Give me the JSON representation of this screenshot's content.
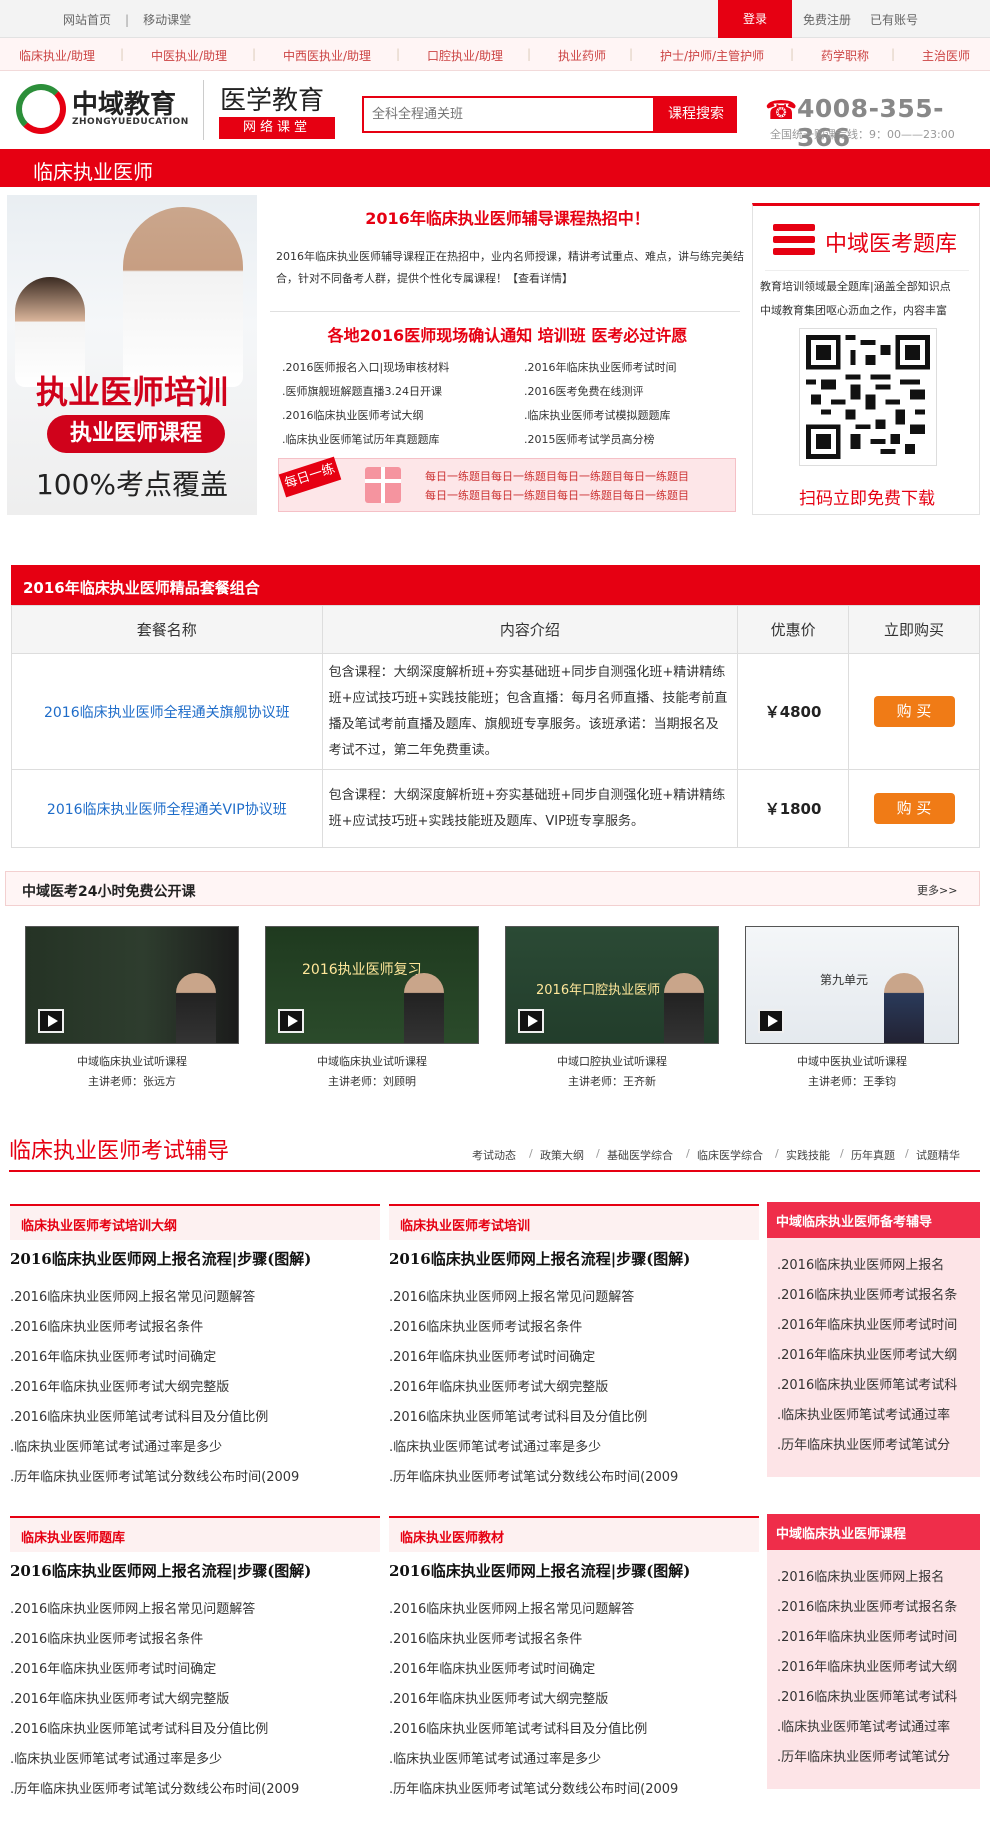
{
  "topbar": {
    "home": "网站首页",
    "mobile": "移动课堂",
    "sep": "|",
    "login": "登录",
    "register": "免费注册",
    "has_account": "已有账号"
  },
  "subnav": {
    "items": [
      "临床执业/助理",
      "中医执业/助理",
      "中西医执业/助理",
      "口腔执业/助理",
      "执业药师",
      "护士/护师/主管护师",
      "药学职称",
      "主治医师"
    ],
    "sep": "|"
  },
  "header": {
    "logo_cn": "中域教育",
    "logo_en": "ZHONGYUEDUCATION",
    "brand": "医学教育",
    "brand_sub": "网络课堂",
    "search_placeholder": "全科全程通关班",
    "search_button": "课程搜索",
    "phone_icon": "☎",
    "phone": "4008-355-366",
    "phone_sub": "全国统一购课专线：9：00——23:00"
  },
  "page_title": "临床执业医师",
  "hero": {
    "line1": "执业医师培训",
    "line2": "执业医师课程",
    "line3": "100%考点覆盖"
  },
  "feature": {
    "headline1": "2016年临床执业医师辅导课程热招中！",
    "paragraph": "2016年临床执业医师辅导课程正在热招中，业内名师授课，精讲考试重点、难点，讲与练完美结合，针对不同备考人群，提供个性化专属课程！【查看详情】",
    "headline2": "各地2016医师现场确认通知 培训班 医考必过许愿",
    "links": [
      ".2016医师报名入口|现场审核材料",
      ".2016年临床执业医师考试时间",
      ".医师旗舰班解题直播3.24日开课",
      ".2016医考免费在线测评",
      ".2016临床执业医师考试大纲",
      ".临床执业医师考试模拟题题库",
      ".临床执业医师笔试历年真题题库",
      ".2015医师考试学员高分榜"
    ],
    "daily_tag": "每日一练",
    "daily_line1": "每日一练题目每日一练题目每日一练题目每日一练题目",
    "daily_line2": "每日一练题目每日一练题目每日一练题目每日一练题目"
  },
  "qr": {
    "title": "中域医考题库",
    "desc1": "教育培训领域最全题库|涵盖全部知识点",
    "desc2": "中域教育集团呕心沥血之作，内容丰富",
    "caption": "扫码立即免费下载"
  },
  "packages": {
    "title": "2016年临床执业医师精品套餐组合",
    "headers": [
      "套餐名称",
      "内容介绍",
      "优惠价",
      "立即购买"
    ],
    "rows": [
      {
        "name": "2016临床执业医师全程通关旗舰协议班",
        "desc": "包含课程：大纲深度解析班+夯实基础班+同步自测强化班+精讲精练班+应试技巧班+实践技能班；包含直播：每月名师直播、技能考前直播及笔试考前直播及题库、旗舰班专享服务。该班承诺：当期报名及考试不过，第二年免费重读。",
        "price": "￥4800",
        "buy": "购 买"
      },
      {
        "name": "2016临床执业医师全程通关VIP协议班",
        "desc": "包含课程：大纲深度解析班+夯实基础班+同步自测强化班+精讲精练班+应试技巧班+实践技能班及题库、VIP班专享服务。",
        "price": "￥1800",
        "buy": "购 买"
      }
    ]
  },
  "open_class": {
    "title": "中域医考24小时免费公开课",
    "more": "更多>>",
    "videos": [
      {
        "title": "中域临床执业试听课程",
        "teacher": "主讲老师：张远方",
        "board": ""
      },
      {
        "title": "中域临床执业试听课程",
        "teacher": "主讲老师：刘顾明",
        "board": "2016执业医师复习"
      },
      {
        "title": "中域口腔执业试听课程",
        "teacher": "主讲老师：王齐新",
        "board": "2016年口腔执业医师"
      },
      {
        "title": "中域中医执业试听课程",
        "teacher": "主讲老师：王季钧",
        "board": "第九单元"
      }
    ]
  },
  "guide": {
    "title": "临床执业医师考试辅导",
    "nav": [
      "考试动态",
      "政策大纲",
      "基础医学综合",
      "临床医学综合",
      "实践技能",
      "历年真题",
      "试题精华"
    ],
    "nav_sep": "/",
    "boxes": [
      {
        "head": "临床执业医师考试培训大纲",
        "headline": "2016临床执业医师网上报名流程|步骤(图解)",
        "items": [
          ".2016临床执业医师网上报名常见问题解答",
          ".2016临床执业医师考试报名条件",
          ".2016年临床执业医师考试时间确定",
          ".2016年临床执业医师考试大纲完整版",
          ".2016临床执业医师笔试考试科目及分值比例",
          ".临床执业医师笔试考试通过率是多少",
          ".历年临床执业医师考试笔试分数线公布时间(2009"
        ]
      },
      {
        "head": "临床执业医师考试培训",
        "headline": "2016临床执业医师网上报名流程|步骤(图解)",
        "items": [
          ".2016临床执业医师网上报名常见问题解答",
          ".2016临床执业医师考试报名条件",
          ".2016年临床执业医师考试时间确定",
          ".2016年临床执业医师考试大纲完整版",
          ".2016临床执业医师笔试考试科目及分值比例",
          ".临床执业医师笔试考试通过率是多少",
          ".历年临床执业医师考试笔试分数线公布时间(2009"
        ]
      },
      {
        "head": "临床执业医师题库",
        "headline": "2016临床执业医师网上报名流程|步骤(图解)",
        "items": [
          ".2016临床执业医师网上报名常见问题解答",
          ".2016临床执业医师考试报名条件",
          ".2016年临床执业医师考试时间确定",
          ".2016年临床执业医师考试大纲完整版",
          ".2016临床执业医师笔试考试科目及分值比例",
          ".临床执业医师笔试考试通过率是多少",
          ".历年临床执业医师考试笔试分数线公布时间(2009"
        ]
      },
      {
        "head": "临床执业医师教材",
        "headline": "2016临床执业医师网上报名流程|步骤(图解)",
        "items": [
          ".2016临床执业医师网上报名常见问题解答",
          ".2016临床执业医师考试报名条件",
          ".2016年临床执业医师考试时间确定",
          ".2016年临床执业医师考试大纲完整版",
          ".2016临床执业医师笔试考试科目及分值比例",
          ".临床执业医师笔试考试通过率是多少",
          ".历年临床执业医师考试笔试分数线公布时间(2009"
        ]
      }
    ],
    "sides": [
      {
        "head": "中域临床执业医师备考辅导",
        "items": [
          ".2016临床执业医师网上报名",
          ".2016临床执业医师考试报名条",
          ".2016年临床执业医师考试时间",
          ".2016年临床执业医师考试大纲",
          ".2016临床执业医师笔试考试科",
          ".临床执业医师笔试考试通过率",
          ".历年临床执业医师考试笔试分"
        ]
      },
      {
        "head": "中域临床执业医师课程",
        "items": [
          ".2016临床执业医师网上报名",
          ".2016临床执业医师考试报名条",
          ".2016年临床执业医师考试时间",
          ".2016年临床执业医师考试大纲",
          ".2016临床执业医师笔试考试科",
          ".临床执业医师笔试考试通过率",
          ".历年临床执业医师考试笔试分"
        ]
      }
    ]
  },
  "colors": {
    "brand_red": "#e60012",
    "link_blue": "#1e6cc9",
    "buy_orange": "#f07b16",
    "side_bg": "#fde4e7"
  }
}
